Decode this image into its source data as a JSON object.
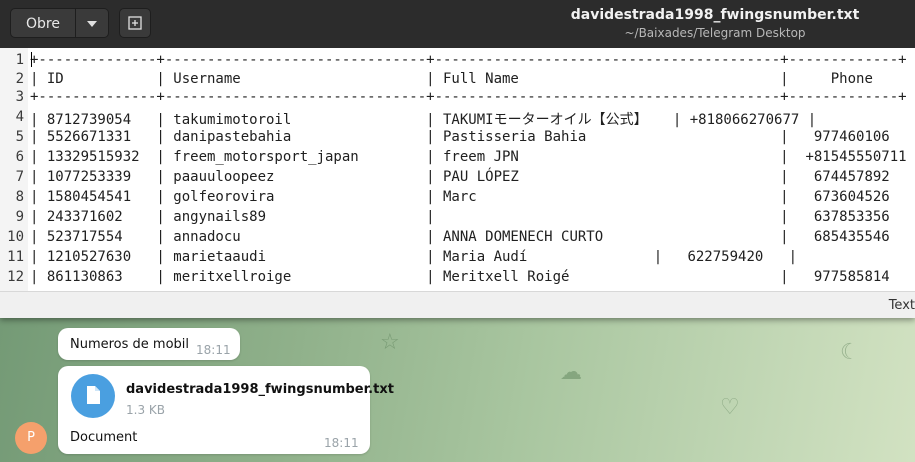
{
  "window": {
    "title": "davidestrada1998_fwingsnumber.txt",
    "subtitle": "~/Baixades/Telegram Desktop",
    "open_button": "Obre",
    "status_language": "Text"
  },
  "editor": {
    "lines": [
      {
        "n": "1",
        "text": "+--------------+-------------------------------+-----------------------------------------+-------------+"
      },
      {
        "n": "2",
        "text": "| ID           | Username                      | Full Name                               |     Phone     |"
      },
      {
        "n": "3",
        "text": "+--------------+-------------------------------+-----------------------------------------+-------------+"
      },
      {
        "n": "4",
        "text": "| 8712739054   | takumimotoroil                | TAKUMIモーターオイル【公式】   | +818066270677 |"
      },
      {
        "n": "5",
        "text": "| 5526671331   | danipastebahia                | Pastisseria Bahia                       |   977460106   |"
      },
      {
        "n": "6",
        "text": "| 13329515932  | freem_motorsport_japan        | freem JPN                               |  +81545550711 |"
      },
      {
        "n": "7",
        "text": "| 1077253339   | paauuloopeez                  | PAU LÓPEZ                               |   674457892   |"
      },
      {
        "n": "8",
        "text": "| 1580454541   | golfeorovira                  | Marc                                    |   673604526   |"
      },
      {
        "n": "9",
        "text": "| 243371602    | angynails89                   |                                         |   637853356   |"
      },
      {
        "n": "10",
        "text": "| 523717554    | annadocu                      | ANNA DOMENECH CURTO                     |   685435546   |"
      },
      {
        "n": "11",
        "text": "| 1210527630   | marietaaudi                   | Maria Audí               |   622759420   |"
      },
      {
        "n": "12",
        "text": "| 861130863    | meritxellroige                | Meritxell Roigé                         |   977585814   |"
      }
    ]
  },
  "chat": {
    "caption": "Numeros de mobil",
    "caption_time": "18:11",
    "file_name": "davidestrada1998_fwingsnumber.txt",
    "file_size": "1.3 KB",
    "doc_label": "Document",
    "doc_time": "18:11",
    "avatar_initial": "P",
    "avatar_color": "#f5a06c",
    "file_icon_color": "#4a9fe0"
  }
}
